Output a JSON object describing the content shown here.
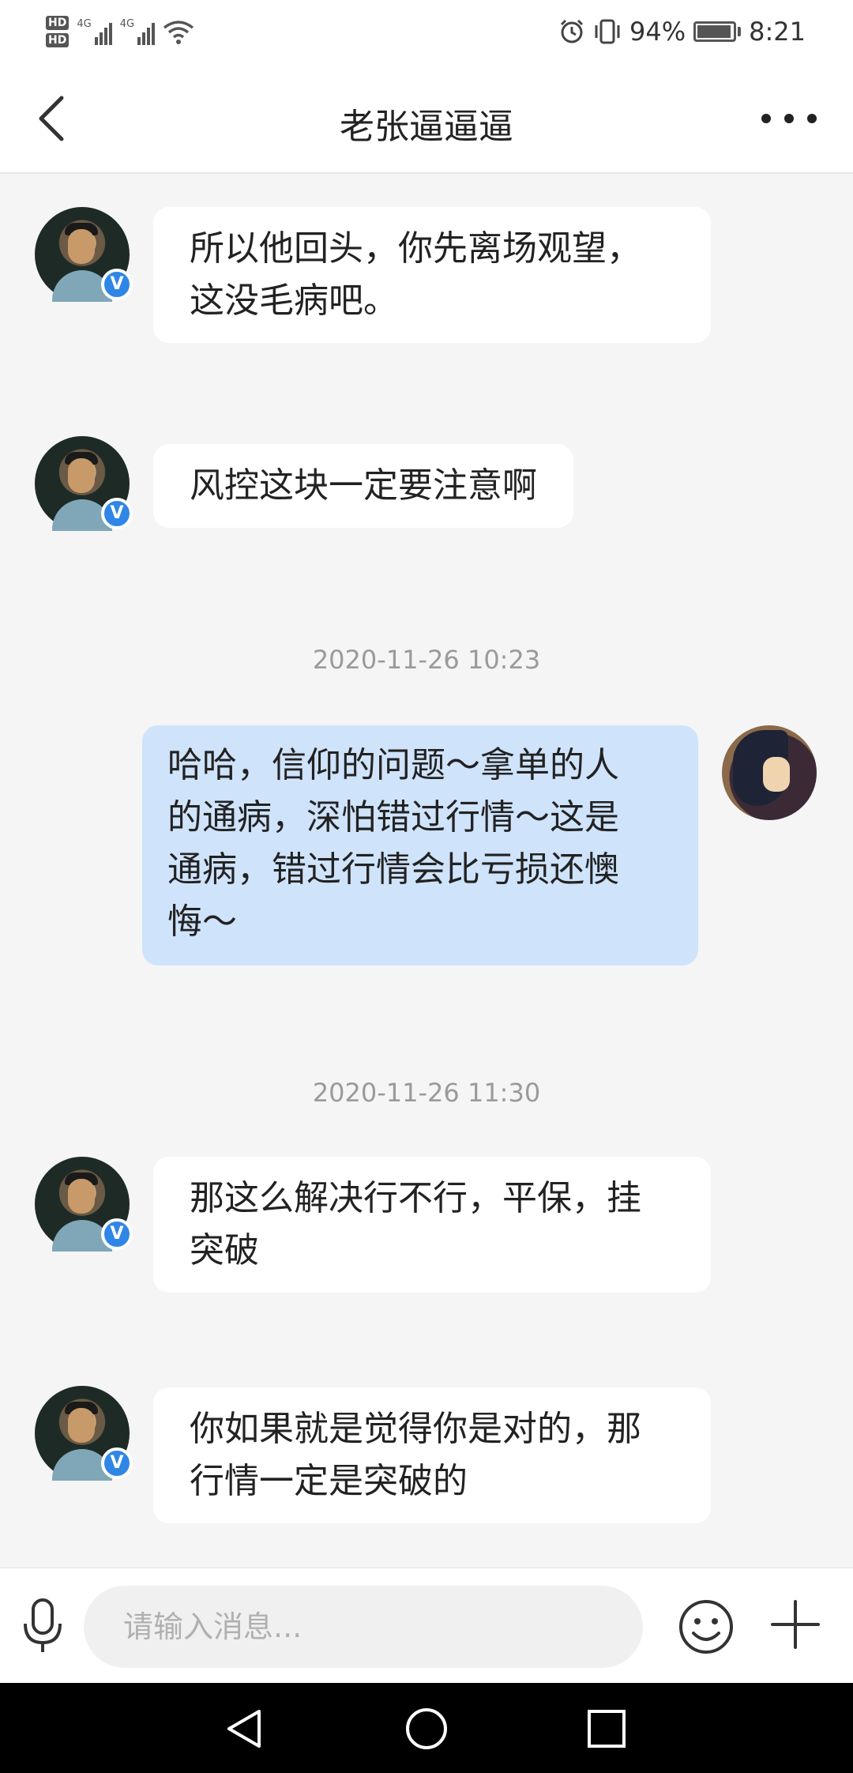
{
  "status_bar": {
    "hd1": "HD",
    "hd2": "HD",
    "net1": "4G",
    "net2": "4G",
    "battery_percent": "94%",
    "time": "8:21",
    "icons": [
      "alarm-icon",
      "vibrate-icon",
      "battery-icon",
      "wifi-icon",
      "signal-icon"
    ]
  },
  "header": {
    "title": "老张逼逼逼",
    "back_icon": "chevron-left-icon",
    "more_icon": "more-horizontal-icon"
  },
  "messages": [
    {
      "sender": "other",
      "lines": [
        "所以他回头，你先离场观望，",
        "这没毛病吧。"
      ]
    },
    {
      "sender": "other",
      "lines": [
        "风控这块一定要注意啊"
      ]
    },
    {
      "timestamp": "2020-11-26 10:23"
    },
    {
      "sender": "me",
      "lines": [
        "哈哈，信仰的问题～拿单的人",
        "的通病，深怕错过行情～这是",
        "通病，错过行情会比亏损还懊",
        "悔～"
      ]
    },
    {
      "timestamp": "2020-11-26 11:30"
    },
    {
      "sender": "other",
      "lines": [
        "那这么解决行不行，平保，挂",
        "突破"
      ]
    },
    {
      "sender": "other",
      "lines": [
        "你如果就是觉得你是对的，那",
        "行情一定是突破的"
      ]
    }
  ],
  "verified_badge": "V",
  "input_bar": {
    "placeholder": "请输入消息...",
    "value": "",
    "icons": [
      "microphone-icon",
      "emoji-icon",
      "plus-icon"
    ]
  },
  "nav_bar": {
    "icons": [
      "nav-back-icon",
      "nav-home-icon",
      "nav-recent-icon"
    ]
  }
}
